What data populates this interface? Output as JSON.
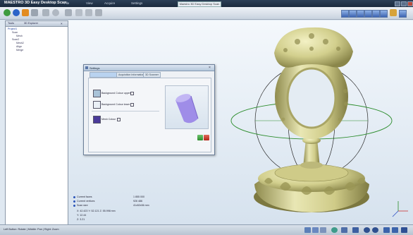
{
  "window": {
    "app_title": "MAESTRO 3D Easy Desktop Scan",
    "document_title": "Maestro 3D Easy Desktop Scan",
    "menus": [
      "File",
      "View",
      "Acquire",
      "Settings"
    ]
  },
  "tree": {
    "tabs": [
      "Tools",
      "3D Explorer"
    ],
    "nodes": [
      "Project1",
      "Scan",
      "Mesh",
      "Scan2",
      "Mesh2",
      "Align",
      "Merge"
    ]
  },
  "dialog": {
    "title": "Settings",
    "tabs": [
      "",
      "Acquisition Information",
      "3D Scanner"
    ],
    "options": [
      {
        "label": "Background Colour upper",
        "color": "#a9c3d8"
      },
      {
        "label": "Background Colour lower",
        "color": "#eaf0f6"
      },
      {
        "label": "Mesh Colour",
        "color": "#4a3a9a"
      }
    ],
    "preview_color": "#9f8de8",
    "ok_label": "",
    "cancel_label": ""
  },
  "info_panel": {
    "rows": [
      {
        "label": "Current faces",
        "value": "1 855 000",
        "color": "#2a54b8"
      },
      {
        "label": "Current vertices",
        "value": "926 486",
        "color": "#2a54b8"
      },
      {
        "label": "Scan size",
        "value": "41x52x56 mm",
        "color": "#2a54b8"
      }
    ],
    "dims": [
      "X: 42.423  Y: 52.121  Z: 55.998 mm",
      "Y: 12.44",
      "Z: 3.21"
    ]
  },
  "statusbar": {
    "text": "Left Button: Rotate | Middle: Pan | Right: Zoom"
  },
  "model": {
    "ring_color": "#d9d79a",
    "shadow_color": "#8f8b4e"
  }
}
